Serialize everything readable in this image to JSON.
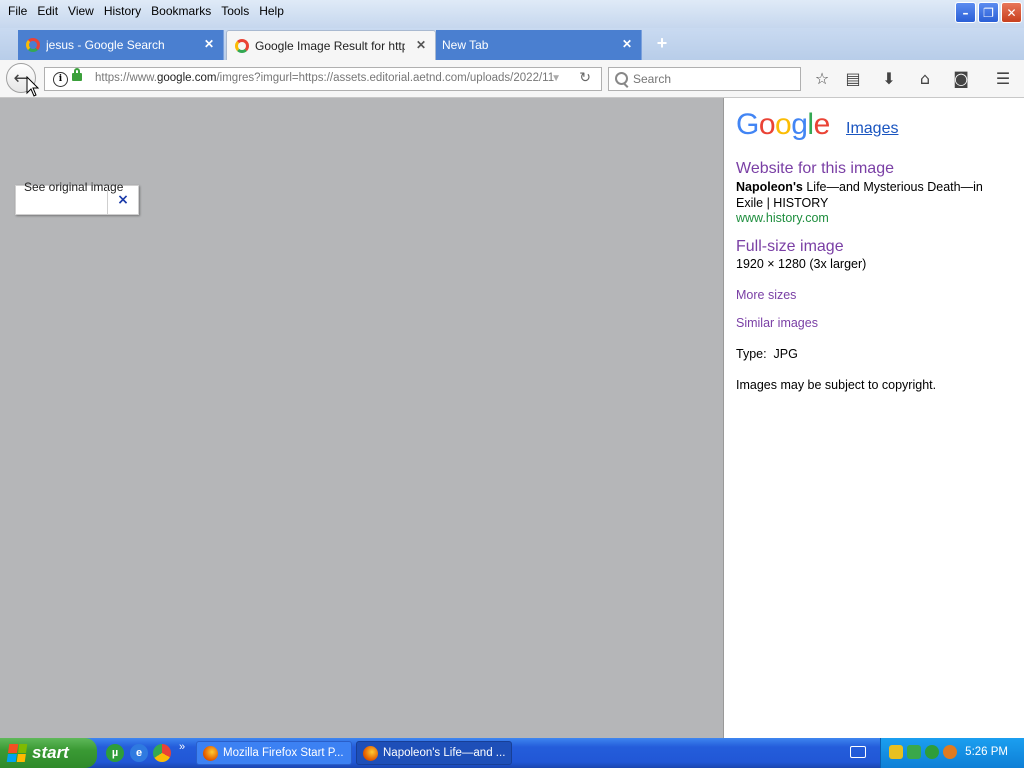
{
  "menu": [
    "File",
    "Edit",
    "View",
    "History",
    "Bookmarks",
    "Tools",
    "Help"
  ],
  "window_controls": {
    "minimize": "–",
    "restore": "❐",
    "close": "✕"
  },
  "tabs": [
    {
      "title": "jesus - Google Search",
      "close": "✕"
    },
    {
      "title": "Google Image Result for http...",
      "close": "✕"
    },
    {
      "title": "New Tab",
      "close": "✕"
    }
  ],
  "newtab_label": "+",
  "nav": {
    "url_prefix": "https://www.",
    "url_domain": "google.com",
    "url_rest": "/imgres?imgurl=https://assets.editorial.aetnd.com/uploads/2022/11",
    "search_placeholder": "Search"
  },
  "viewer": {
    "see_original": "See original image",
    "close": "×"
  },
  "panel": {
    "logo_letters": [
      "G",
      "o",
      "o",
      "g",
      "l",
      "e"
    ],
    "logo_colors": [
      "#4285f4",
      "#ea4335",
      "#fbbc05",
      "#4285f4",
      "#34a853",
      "#ea4335"
    ],
    "images_link": "Images",
    "website_heading": "Website for this image",
    "title_bold": "Napoleon's",
    "title_rest": " Life—and Mysterious Death—in Exile | HISTORY",
    "site_url": "www.history.com",
    "fullsize_heading": "Full-size image",
    "dimensions": "1920 × 1280 (3x larger)",
    "more_sizes": "More sizes",
    "similar_images": "Similar images",
    "type_label": "Type:",
    "type_value": "JPG",
    "copyright": "Images may be subject to copyright."
  },
  "taskbar": {
    "start": "start",
    "items": [
      {
        "label": "Mozilla Firefox Start P..."
      },
      {
        "label": "Napoleon's Life—and ..."
      }
    ],
    "clock": "5:26 PM"
  },
  "colors": {
    "link_purple": "#7a3fa5",
    "link_blue": "#1a55c0",
    "url_green": "#1e8e3e",
    "viewer_bg": "#b5b6b8"
  }
}
